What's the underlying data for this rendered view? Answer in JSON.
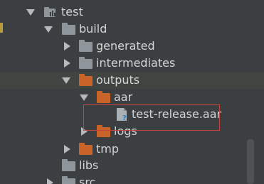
{
  "project_tree": {
    "items": [
      {
        "label": "test"
      },
      {
        "label": "build"
      },
      {
        "label": "generated"
      },
      {
        "label": "intermediates"
      },
      {
        "label": "outputs"
      },
      {
        "label": "aar"
      },
      {
        "label": "test-release.aar"
      },
      {
        "label": "logs"
      },
      {
        "label": "tmp"
      },
      {
        "label": "libs"
      },
      {
        "label": "src"
      }
    ]
  },
  "colors": {
    "background": "#3c3f41",
    "text": "#d4d4d4",
    "folder_gray": "#8e969c",
    "folder_orange": "#c8632a",
    "highlight_border": "#c4453e"
  }
}
